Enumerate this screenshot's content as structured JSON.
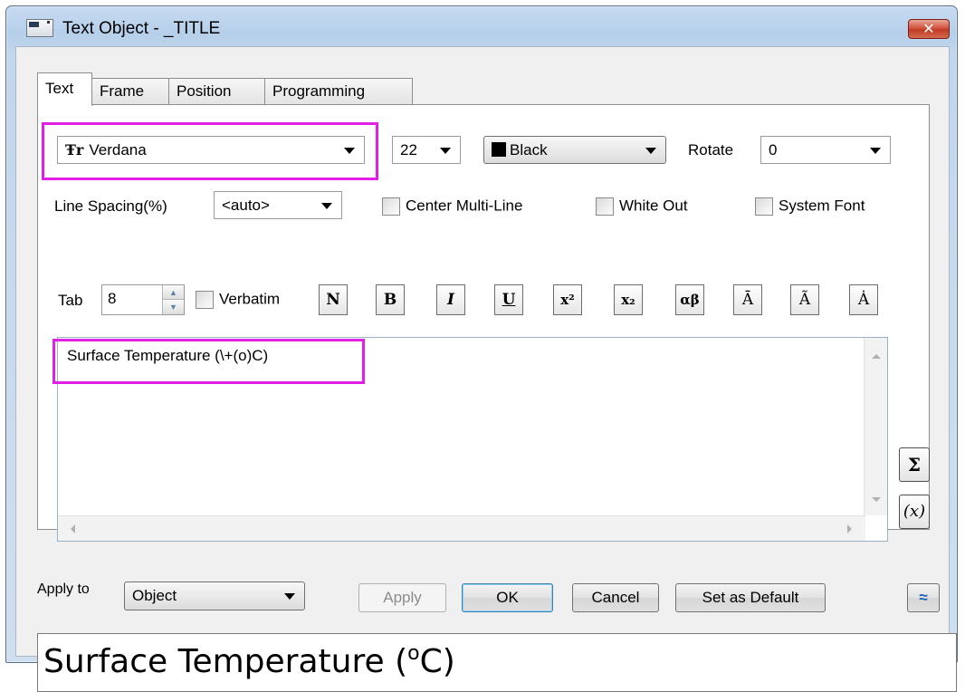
{
  "window": {
    "title": "Text Object - _TITLE",
    "close_glyph": "✕"
  },
  "tabs": [
    {
      "label": "Text",
      "active": true
    },
    {
      "label": "Frame",
      "active": false
    },
    {
      "label": "Position",
      "active": false
    },
    {
      "label": "Programming",
      "active": false
    }
  ],
  "font": {
    "icon": "font-type-icon",
    "glyph": "Ŧr",
    "name": "Verdana"
  },
  "size": {
    "value": "22"
  },
  "color": {
    "name": "Black",
    "swatch": "#000000"
  },
  "rotate": {
    "label": "Rotate",
    "value": "0"
  },
  "line_spacing": {
    "label": "Line Spacing(%)",
    "value": "<auto>"
  },
  "checkboxes": {
    "center_multiline": {
      "label": "Center Multi-Line",
      "checked": false
    },
    "white_out": {
      "label": "White Out",
      "checked": false
    },
    "system_font": {
      "label": "System Font",
      "checked": false
    },
    "verbatim": {
      "label": "Verbatim",
      "checked": false
    }
  },
  "tab_stop": {
    "label": "Tab",
    "value": "8"
  },
  "format_buttons": [
    {
      "name": "normal-button",
      "glyph": "N"
    },
    {
      "name": "bold-button",
      "glyph": "B"
    },
    {
      "name": "italic-button",
      "glyph": "I"
    },
    {
      "name": "underline-button",
      "glyph": "U"
    },
    {
      "name": "superscript-button",
      "glyph": "x²"
    },
    {
      "name": "subscript-button",
      "glyph": "x₂"
    },
    {
      "name": "greek-button",
      "glyph": "αβ"
    },
    {
      "name": "overbar-button",
      "glyph": "Ā"
    },
    {
      "name": "tilde-button",
      "glyph": "Ã"
    },
    {
      "name": "dot-button",
      "glyph": "Ȧ"
    }
  ],
  "editor": {
    "text": "Surface Temperature (\\+(o)C)"
  },
  "side_buttons": {
    "sigma": "Σ",
    "variable": "(x)"
  },
  "apply_to": {
    "label": "Apply to",
    "value": "Object"
  },
  "buttons": {
    "apply": "Apply",
    "ok": "OK",
    "cancel": "Cancel",
    "set_default": "Set as Default",
    "collapse": "≈"
  },
  "preview": {
    "text_main": "Surface Temperature (",
    "text_sup": "o",
    "text_end": "C)"
  },
  "colors": {
    "highlight": "#e020e8",
    "accent": "#3c7fb1"
  }
}
